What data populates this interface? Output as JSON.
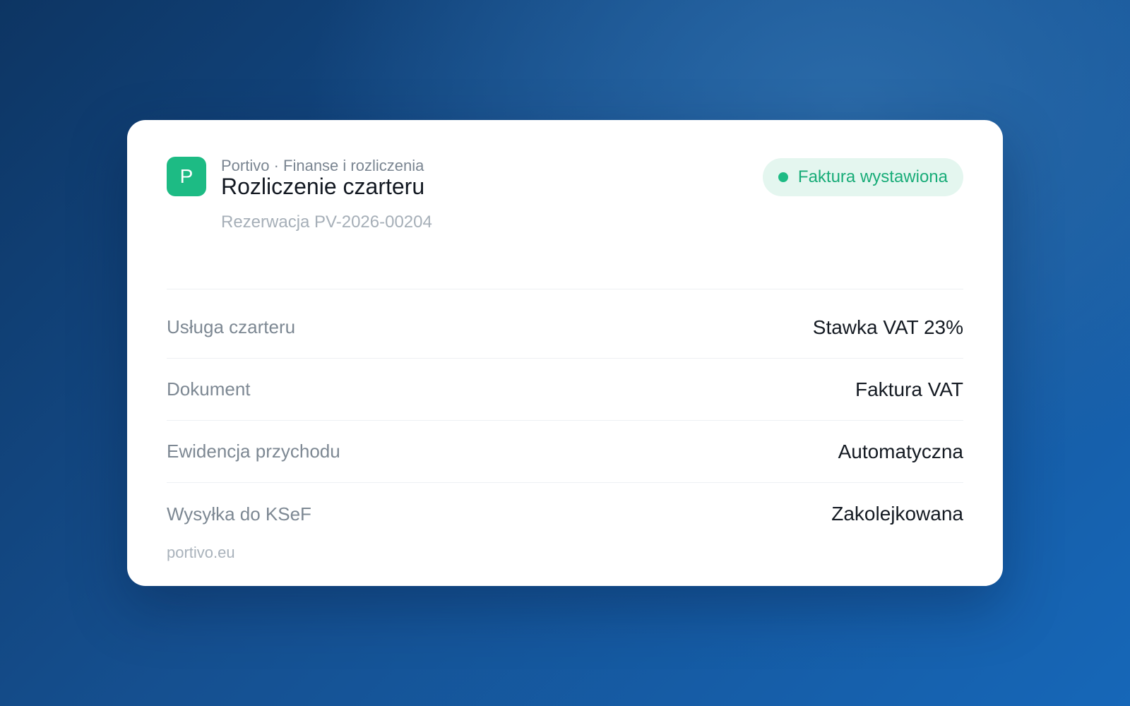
{
  "card": {
    "logo_letter": "P",
    "org": "Portivo · Finanse i rozliczenia",
    "title": "Rozliczenie czarteru",
    "reservation": "Rezerwacja PV-2026-00204",
    "badge": {
      "label": "Faktura wystawiona",
      "color": "#1dbb84"
    },
    "rows": [
      {
        "label": "Usługa czarteru",
        "value": "Stawka VAT 23%"
      },
      {
        "label": "Dokument",
        "value": "Faktura VAT"
      },
      {
        "label": "Ewidencja przychodu",
        "value": "Automatyczna"
      },
      {
        "label": "Wysyłka do KSeF",
        "value": "Zakolejkowana"
      }
    ],
    "footer": "portivo.eu"
  },
  "colors": {
    "accent": "#1dbb84",
    "background_start": "#0d3563",
    "background_end": "#1667b8"
  }
}
